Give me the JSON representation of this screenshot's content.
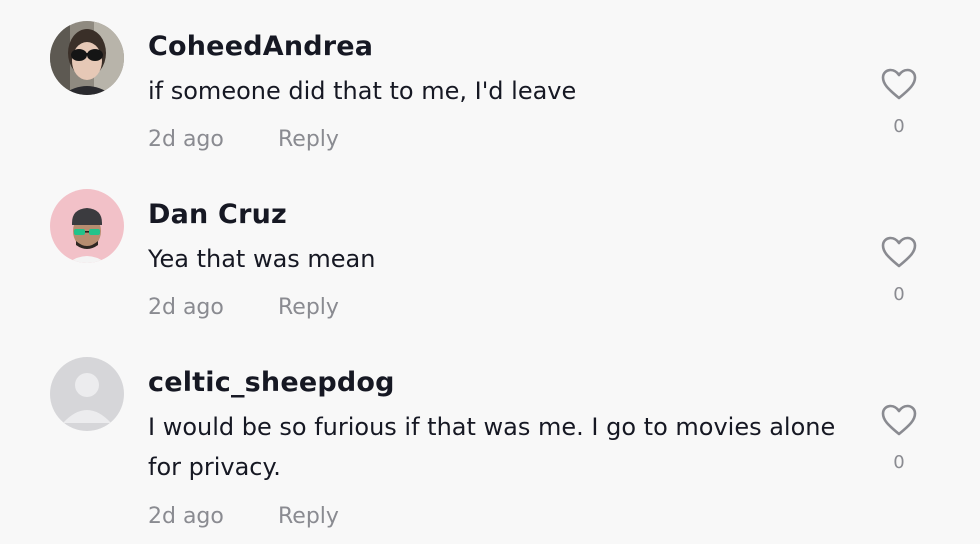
{
  "comments": [
    {
      "username": "CoheedAndrea",
      "text": "if someone did that to me, I'd leave",
      "time": "2d ago",
      "reply_label": "Reply",
      "likes": "0",
      "avatar": "user-photo-sunglasses"
    },
    {
      "username": "Dan Cruz",
      "text": "Yea that was mean",
      "time": "2d ago",
      "reply_label": "Reply",
      "likes": "0",
      "avatar": "user-photo-green-glasses"
    },
    {
      "username": "celtic_sheepdog",
      "text": "I would be so furious if that was me. I go to movies alone for privacy.",
      "time": "2d ago",
      "reply_label": "Reply",
      "likes": "0",
      "avatar": "default-avatar"
    }
  ],
  "icons": {
    "like": "heart-outline-icon"
  },
  "colors": {
    "background": "#f8f8f8",
    "username": "#161823",
    "text": "#161823",
    "meta": "#8a8b91",
    "heart": "#8a8b91"
  }
}
